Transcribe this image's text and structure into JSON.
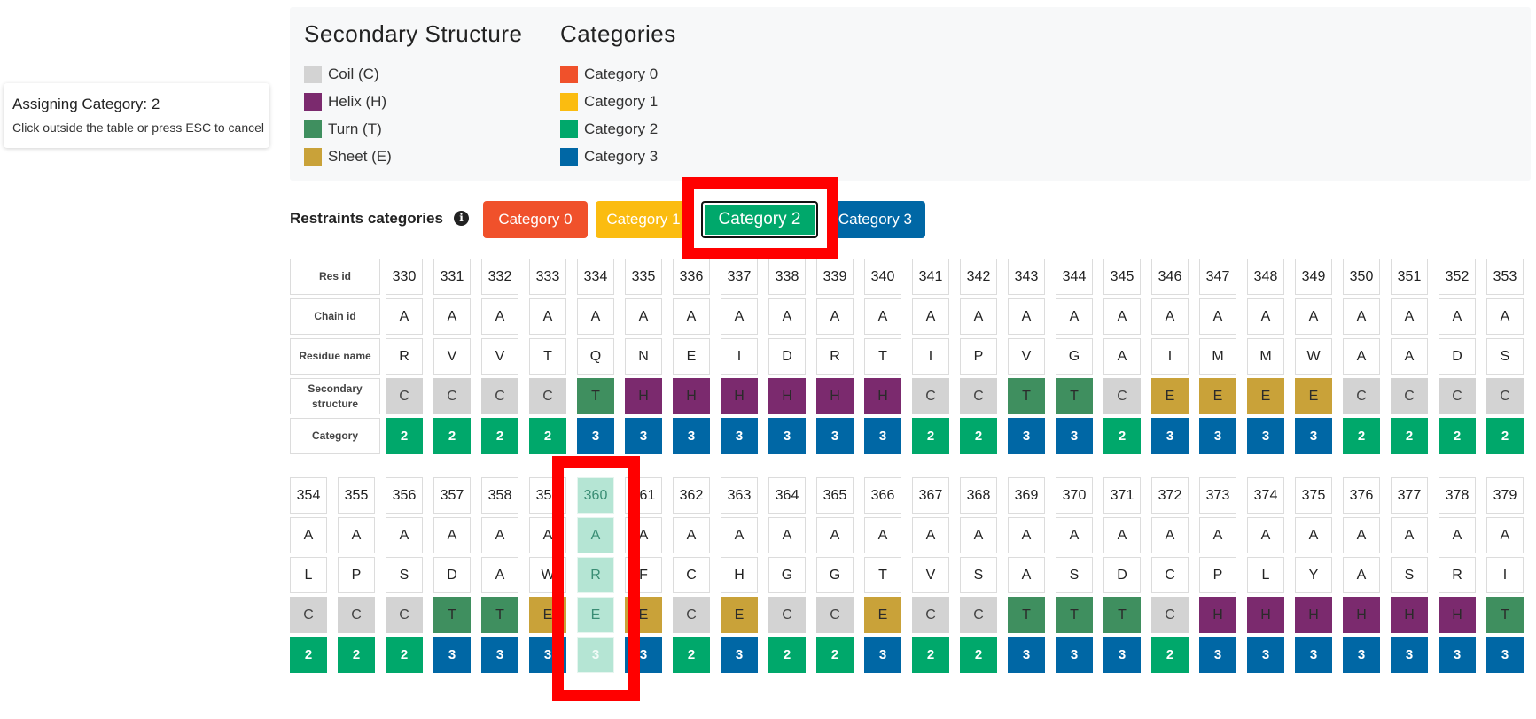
{
  "tooltip": {
    "title": "Assigning Category: 2",
    "hint": "Click outside the table or press ESC to cancel"
  },
  "legend": {
    "secondary_title": "Secondary Structure",
    "categories_title": "Categories",
    "secondary": [
      {
        "label": "Coil (C)",
        "color": "#d3d3d3"
      },
      {
        "label": "Helix (H)",
        "color": "#7b2a6e"
      },
      {
        "label": "Turn (T)",
        "color": "#3f8f5f"
      },
      {
        "label": "Sheet (E)",
        "color": "#c9a239"
      }
    ],
    "categories": [
      {
        "label": "Category 0",
        "color": "#f0512b"
      },
      {
        "label": "Category 1",
        "color": "#fbbc10"
      },
      {
        "label": "Category 2",
        "color": "#00a86b"
      },
      {
        "label": "Category 3",
        "color": "#0067a5"
      }
    ]
  },
  "restraints": {
    "label": "Restraints categories",
    "info_icon": "info-circle-icon",
    "buttons": [
      "Category 0",
      "Category 1",
      "Category 2",
      "Category 3"
    ],
    "active_index": 2
  },
  "row_headers": [
    "Res id",
    "Chain id",
    "Residue name",
    "Secondary structure",
    "Category"
  ],
  "colors": {
    "ss": {
      "C": "#d3d3d3",
      "H": "#7b2a6e",
      "T": "#3f8f5f",
      "E": "#c9a239"
    },
    "cat": {
      "0": "#f0512b",
      "1": "#fbbc10",
      "2": "#00a86b",
      "3": "#0067a5"
    },
    "highlight": "#ff0000"
  },
  "blocks": [
    {
      "res_ids": [
        "330",
        "331",
        "332",
        "333",
        "334",
        "335",
        "336",
        "337",
        "338",
        "339",
        "340",
        "341",
        "342",
        "343",
        "344",
        "345",
        "346",
        "347",
        "348",
        "349",
        "350",
        "351",
        "352",
        "353"
      ],
      "chains": [
        "A",
        "A",
        "A",
        "A",
        "A",
        "A",
        "A",
        "A",
        "A",
        "A",
        "A",
        "A",
        "A",
        "A",
        "A",
        "A",
        "A",
        "A",
        "A",
        "A",
        "A",
        "A",
        "A",
        "A"
      ],
      "residues": [
        "R",
        "V",
        "V",
        "T",
        "Q",
        "N",
        "E",
        "I",
        "D",
        "R",
        "T",
        "I",
        "P",
        "V",
        "G",
        "A",
        "I",
        "M",
        "M",
        "W",
        "A",
        "A",
        "D",
        "S"
      ],
      "ss": [
        "C",
        "C",
        "C",
        "C",
        "T",
        "H",
        "H",
        "H",
        "H",
        "H",
        "H",
        "C",
        "C",
        "T",
        "T",
        "C",
        "E",
        "E",
        "E",
        "E",
        "C",
        "C",
        "C",
        "C"
      ],
      "categories": [
        "2",
        "2",
        "2",
        "2",
        "3",
        "3",
        "3",
        "3",
        "3",
        "3",
        "3",
        "2",
        "2",
        "3",
        "3",
        "2",
        "3",
        "3",
        "3",
        "3",
        "2",
        "2",
        "2",
        "2"
      ]
    },
    {
      "res_ids": [
        "354",
        "355",
        "356",
        "357",
        "358",
        "359",
        "360",
        "361",
        "362",
        "363",
        "364",
        "365",
        "366",
        "367",
        "368",
        "369",
        "370",
        "371",
        "372",
        "373",
        "374",
        "375",
        "376",
        "377",
        "378",
        "379"
      ],
      "chains": [
        "A",
        "A",
        "A",
        "A",
        "A",
        "A",
        "A",
        "A",
        "A",
        "A",
        "A",
        "A",
        "A",
        "A",
        "A",
        "A",
        "A",
        "A",
        "A",
        "A",
        "A",
        "A",
        "A",
        "A",
        "A",
        "A"
      ],
      "residues": [
        "L",
        "P",
        "S",
        "D",
        "A",
        "W",
        "R",
        "F",
        "C",
        "H",
        "G",
        "G",
        "T",
        "V",
        "S",
        "A",
        "S",
        "D",
        "C",
        "P",
        "L",
        "Y",
        "A",
        "S",
        "R",
        "I"
      ],
      "ss": [
        "C",
        "C",
        "C",
        "T",
        "T",
        "E",
        "E",
        "E",
        "C",
        "E",
        "C",
        "C",
        "E",
        "C",
        "C",
        "T",
        "T",
        "T",
        "C",
        "H",
        "H",
        "H",
        "H",
        "H",
        "H",
        "T"
      ],
      "categories": [
        "2",
        "2",
        "2",
        "3",
        "3",
        "3",
        "3",
        "3",
        "2",
        "3",
        "2",
        "2",
        "3",
        "2",
        "2",
        "3",
        "3",
        "3",
        "2",
        "3",
        "3",
        "3",
        "3",
        "3",
        "3",
        "3"
      ],
      "selected_index": 6
    }
  ]
}
